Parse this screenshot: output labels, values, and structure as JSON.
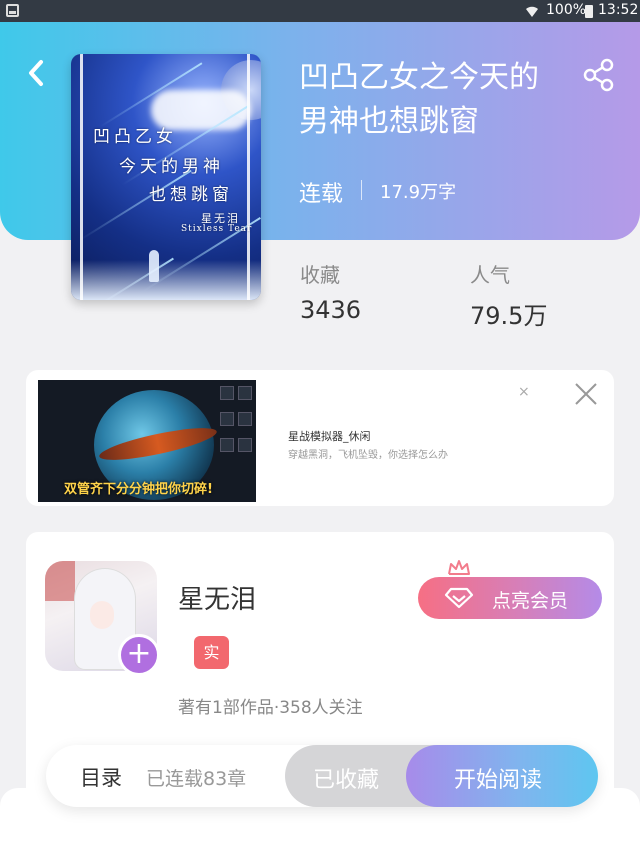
{
  "status_bar": {
    "battery": "100%",
    "time": "13:52"
  },
  "book": {
    "title": "凹凸乙女之今天的男神也想跳窗",
    "status": "连载",
    "word_count": "17.9万字",
    "cover_text": {
      "line1": "凹凸乙女",
      "line2": "今天的男神",
      "line3": "也想跳窗",
      "author_mark": "星无泪",
      "signature": "Stixless Tear"
    },
    "stats": [
      {
        "label": "收藏",
        "value": "3436"
      },
      {
        "label": "人气",
        "value": "79.5万"
      }
    ]
  },
  "ad": {
    "title": "星战模拟器_休闲",
    "description": "穿越黑洞，飞机坠毁，你选择怎么办",
    "banner": "双管齐下分分钟把你切碎!",
    "small_close": "×"
  },
  "author": {
    "name": "星无泪",
    "badge": "实",
    "stats": "著有1部作品·358人关注",
    "follow_symbol": "+",
    "vip_label": "点亮会员"
  },
  "bottom_bar": {
    "toc_label": "目录",
    "chapter_count": "已连载83章",
    "collected_label": "已收藏",
    "start_label": "开始阅读"
  },
  "colors": {
    "header_gradient": [
      "#3fc9ea",
      "#b59ae8"
    ],
    "vip_gradient": [
      "#f66f84",
      "#b48be8"
    ],
    "start_gradient": [
      "#a78bea",
      "#5ec6f0"
    ],
    "badge": "#f2686e",
    "follow_button": "#b06fe0"
  }
}
